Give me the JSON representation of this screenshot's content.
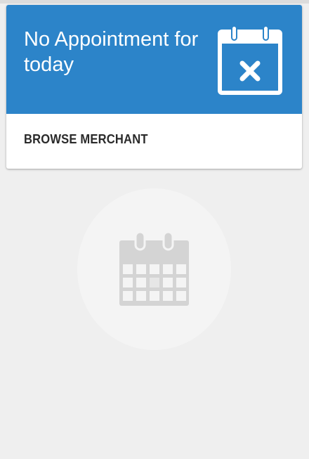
{
  "appointment_card": {
    "title": "No Appointment for today",
    "action_label": "BROWSE MERCHANT"
  },
  "icons": {
    "header_icon": "calendar-x-icon",
    "empty_state_icon": "calendar-icon"
  },
  "colors": {
    "accent": "#2c84c9",
    "background": "#efefef"
  }
}
